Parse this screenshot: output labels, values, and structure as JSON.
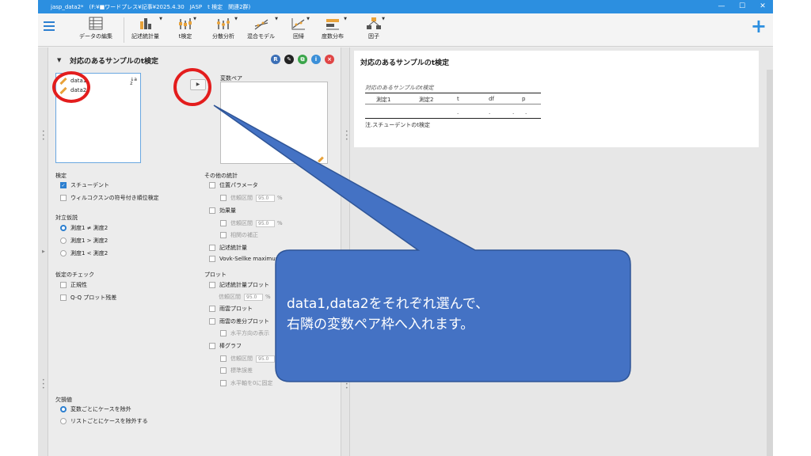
{
  "titlebar": {
    "title": "jasp_data2*　(F:¥■ワードプレス¥記事¥2025.4.30　JASP　t 検定　関連2群)",
    "minimize": "—",
    "maximize": "☐",
    "close": "✕"
  },
  "toolbar": {
    "edit_data": "データの編集",
    "descriptives": "記述統計量",
    "ttest": "t検定",
    "anova": "分散分析",
    "mixed": "混合モデル",
    "regression": "回帰",
    "frequencies": "度数分布",
    "factor": "因子",
    "plus": "+"
  },
  "panel": {
    "title": "対応のあるサンプルのt検定",
    "icons": {
      "r": "R",
      "info": "i",
      "close": "×"
    },
    "variables": [
      "data1",
      "data2"
    ],
    "pairs_label": "変数ペア",
    "move_arrow": "▶",
    "test_label": "検定",
    "student": "スチューデント",
    "wilcoxon": "ウィルコクスンの符号付き順位検定",
    "alt_label": "対立仮説",
    "alt1": "測度1 ≠ 測度2",
    "alt2": "測度1 > 測度2",
    "alt3": "測度1 < 測度2",
    "assump_label": "仮定のチェック",
    "normality": "正規性",
    "qq": "Q-Q プロット残差",
    "other_label": "その他の統計",
    "location": "位置パラメータ",
    "ci": "信頼区間",
    "ci_value": "95.0",
    "pct": "%",
    "effect": "効果量",
    "corr_adj": "相関の補正",
    "desc": "記述統計量",
    "vovk": "Vovk-Sellke maximum p",
    "plots_label": "プロット",
    "desc_plot": "記述統計量プロット",
    "rain": "雨雲プロット",
    "rain_diff": "雨雲の差分プロット",
    "horizontal": "水平方向の表示",
    "bar": "棒グラフ",
    "se": "標準誤差",
    "fix_axis": "水平軸を0に固定",
    "missing_label": "欠損値",
    "exclude_var": "変数ごとにケースを除外",
    "exclude_list": "リストごとにケースを除外する"
  },
  "results": {
    "title": "対応のあるサンプルのt検定",
    "table_caption": "対応のあるサンプルのt検定",
    "headers": [
      "測定1",
      "測定2",
      "t",
      "df",
      "p"
    ],
    "dots": [
      ".",
      ".",
      ".",
      "."
    ],
    "note": "注.スチューデントのt検定"
  },
  "callout": {
    "line1": "data1,data2をそれぞれ選んで、",
    "line2": "右隣の変数ペア枠へ入れます。",
    "fill": "#4472c4",
    "border": "#2f5597"
  },
  "colors": {
    "accent": "#2c8fe0",
    "annotation_red": "#e31d1d"
  }
}
